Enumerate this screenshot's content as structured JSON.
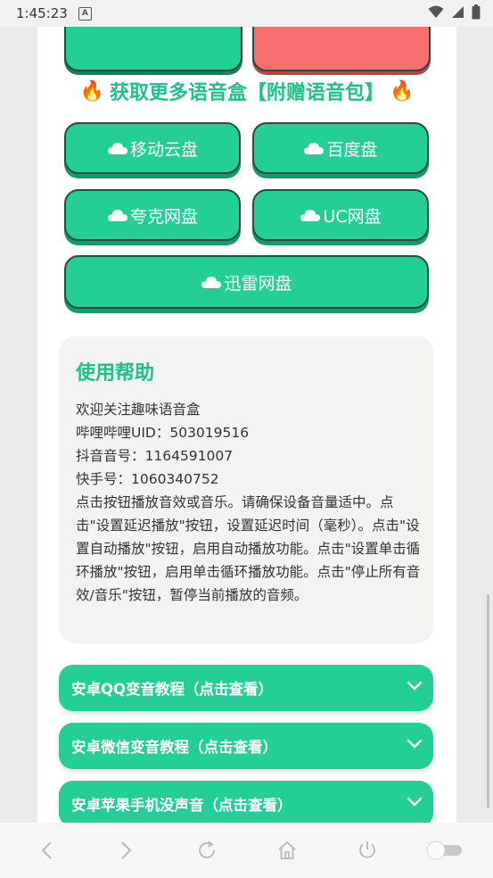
{
  "status_bar": {
    "time": "1:45:23",
    "notification_badge": "A"
  },
  "section": {
    "title": "获取更多语音盒【附赠语音包】",
    "icon_left": "🔥",
    "icon_right": "🔥"
  },
  "download_buttons": [
    {
      "label": "移动云盘",
      "icon": "cloud-icon"
    },
    {
      "label": "百度盘",
      "icon": "cloud-icon"
    },
    {
      "label": "夸克网盘",
      "icon": "cloud-icon"
    },
    {
      "label": "UC网盘",
      "icon": "cloud-icon"
    },
    {
      "label": "迅雷网盘",
      "icon": "cloud-icon"
    }
  ],
  "help": {
    "title": "使用帮助",
    "lines": [
      "欢迎关注趣味语音盒",
      "哔哩哔哩UID：503019516",
      "抖音音号：1164591007",
      "快手号：1060340752",
      "点击按钮播放音效或音乐。请确保设备音量适中。点击\"设置延迟播放\"按钮，设置延迟时间（毫秒）。点击\"设置自动播放\"按钮，启用自动播放功能。点击\"设置单击循环播放\"按钮，启用单击循环播放功能。点击\"停止所有音效/音乐\"按钮，暂停当前播放的音频。"
    ]
  },
  "accordions": [
    {
      "label": "安卓QQ变音教程（点击查看）"
    },
    {
      "label": "安卓微信变音教程（点击查看）"
    },
    {
      "label": "安卓苹果手机没声音（点击查看）"
    }
  ],
  "colors": {
    "accent": "#23cf95",
    "title": "#20c08b",
    "danger": "#f76e6e"
  }
}
